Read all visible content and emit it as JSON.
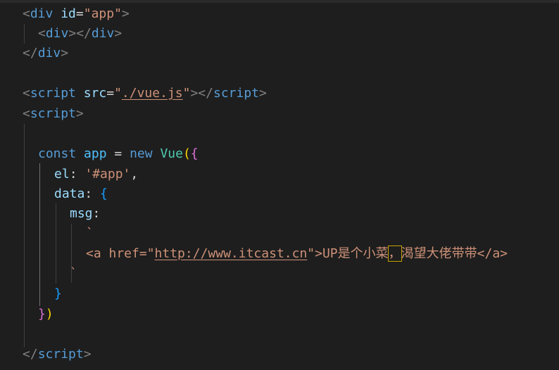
{
  "code": {
    "l1": {
      "open": "<",
      "tag": "div",
      "attr": "id",
      "eq": "=",
      "val": "\"app\"",
      "close": ">"
    },
    "l2": {
      "a": "<",
      "tag1": "div",
      "b": "></",
      "tag2": "div",
      "c": ">"
    },
    "l3": {
      "a": "</",
      "tag": "div",
      "c": ">"
    },
    "l5": {
      "a": "<",
      "tag1": "script",
      "attr": "src",
      "eq": "=",
      "q1": "\"",
      "src": "./vue.js",
      "q2": "\"",
      "b": "></",
      "tag2": "script",
      "c": ">"
    },
    "l6": {
      "a": "<",
      "tag": "script",
      "c": ">"
    },
    "l8": {
      "kw": "const",
      "var": "app",
      "op": "=",
      "new": "new",
      "cls": "Vue",
      "p1": "(",
      "p2": "{"
    },
    "l9": {
      "prop": "el",
      "colon": ":",
      "str": "'#app'",
      "comma": ","
    },
    "l10": {
      "prop": "data",
      "colon": ":",
      "brace": "{"
    },
    "l11": {
      "prop": "msg",
      "colon": ":"
    },
    "l12": {
      "tick": "`"
    },
    "l13": {
      "pre": "<a href=\"",
      "url": "http://www.itcast.cn",
      "mid": "\">UP是个小菜",
      "cursor": "，",
      "post": "渴望大佬带带</a>"
    },
    "l14": {
      "tick": "`"
    },
    "l15": {
      "brace": "}"
    },
    "l16": {
      "brace": "}",
      "paren": ")"
    },
    "l18": {
      "a": "</",
      "tag": "script",
      "c": ">"
    }
  },
  "colors": {
    "background": "#1e1e1e",
    "tag": "#569cd6",
    "attribute": "#9cdcfe",
    "string": "#ce9178",
    "bracket_gold": "#ffd700",
    "bracket_pink": "#da70d6",
    "bracket_blue": "#179fff"
  }
}
